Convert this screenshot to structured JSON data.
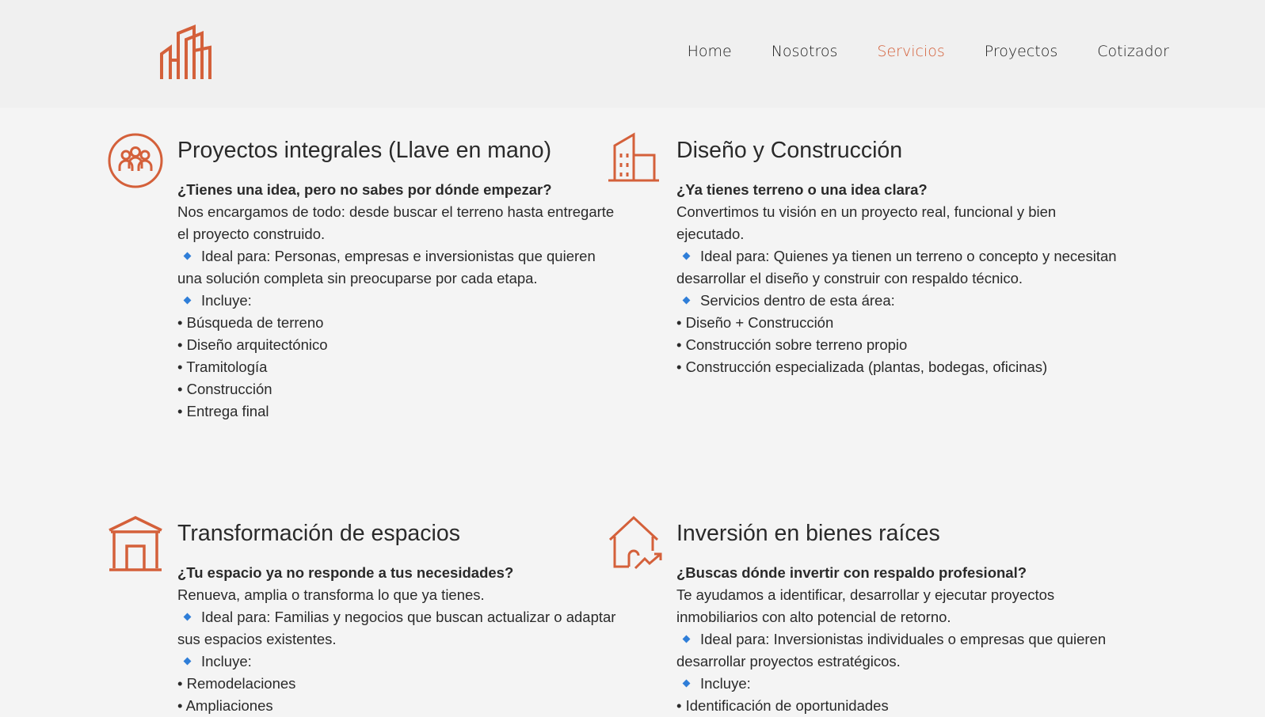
{
  "colors": {
    "accent": "#d4603a",
    "diamond": "#2f7ed8",
    "text": "#2a2a2a",
    "background": "#f4f4f4"
  },
  "logo": {
    "icon": "buildings-logo-icon"
  },
  "nav": {
    "items": [
      {
        "label": "Home",
        "active": false
      },
      {
        "label": "Nosotros",
        "active": false
      },
      {
        "label": "Servicios",
        "active": true
      },
      {
        "label": "Proyectos",
        "active": false
      },
      {
        "label": "Cotizador",
        "active": false
      }
    ]
  },
  "cards": [
    {
      "icon": "people-circle-icon",
      "title": "Proyectos integrales (Llave en mano)",
      "question": "¿Tienes una idea, pero no sabes por dónde empezar?",
      "description": "Nos encargamos de todo: desde buscar el terreno hasta entregarte el proyecto construido.",
      "ideal": "Ideal para: Personas, empresas e inversionistas que quieren una solución completa sin preocuparse por cada etapa.",
      "includes_label": "Incluye:",
      "items": [
        "• Búsqueda de terreno",
        "• Diseño arquitectónico",
        "• Tramitología",
        "• Construcción",
        "• Entrega final"
      ]
    },
    {
      "icon": "building-icon",
      "title": "Diseño y Construcción",
      "question": "¿Ya tienes terreno o una idea clara?",
      "description": "Convertimos tu visión en un proyecto real, funcional y bien ejecutado.",
      "ideal": "Ideal para: Quienes ya tienen un terreno o concepto y necesitan desarrollar el diseño y construir con respaldo técnico.",
      "includes_label": "Servicios dentro de esta área:",
      "items": [
        "• Diseño + Construcción",
        "• Construcción sobre terreno propio",
        "• Construcción especializada (plantas, bodegas, oficinas)"
      ]
    },
    {
      "icon": "storefront-icon",
      "title": "Transformación de espacios",
      "question": "¿Tu espacio ya no responde a tus necesidades?",
      "description": "Renueva, amplia o transforma lo que ya tienes.",
      "ideal": "Ideal para: Familias y negocios que buscan actualizar o adaptar sus espacios existentes.",
      "includes_label": "Incluye:",
      "items": [
        "• Remodelaciones",
        "• Ampliaciones"
      ]
    },
    {
      "icon": "house-growth-icon",
      "title": "Inversión en bienes raíces",
      "question": "¿Buscas dónde invertir con respaldo profesional?",
      "description": "Te ayudamos a identificar, desarrollar y ejecutar proyectos inmobiliarios con alto potencial de retorno.",
      "ideal": "Ideal para: Inversionistas individuales o empresas que quieren desarrollar proyectos estratégicos.",
      "includes_label": "Incluye:",
      "items": [
        "• Identificación de oportunidades"
      ]
    }
  ]
}
